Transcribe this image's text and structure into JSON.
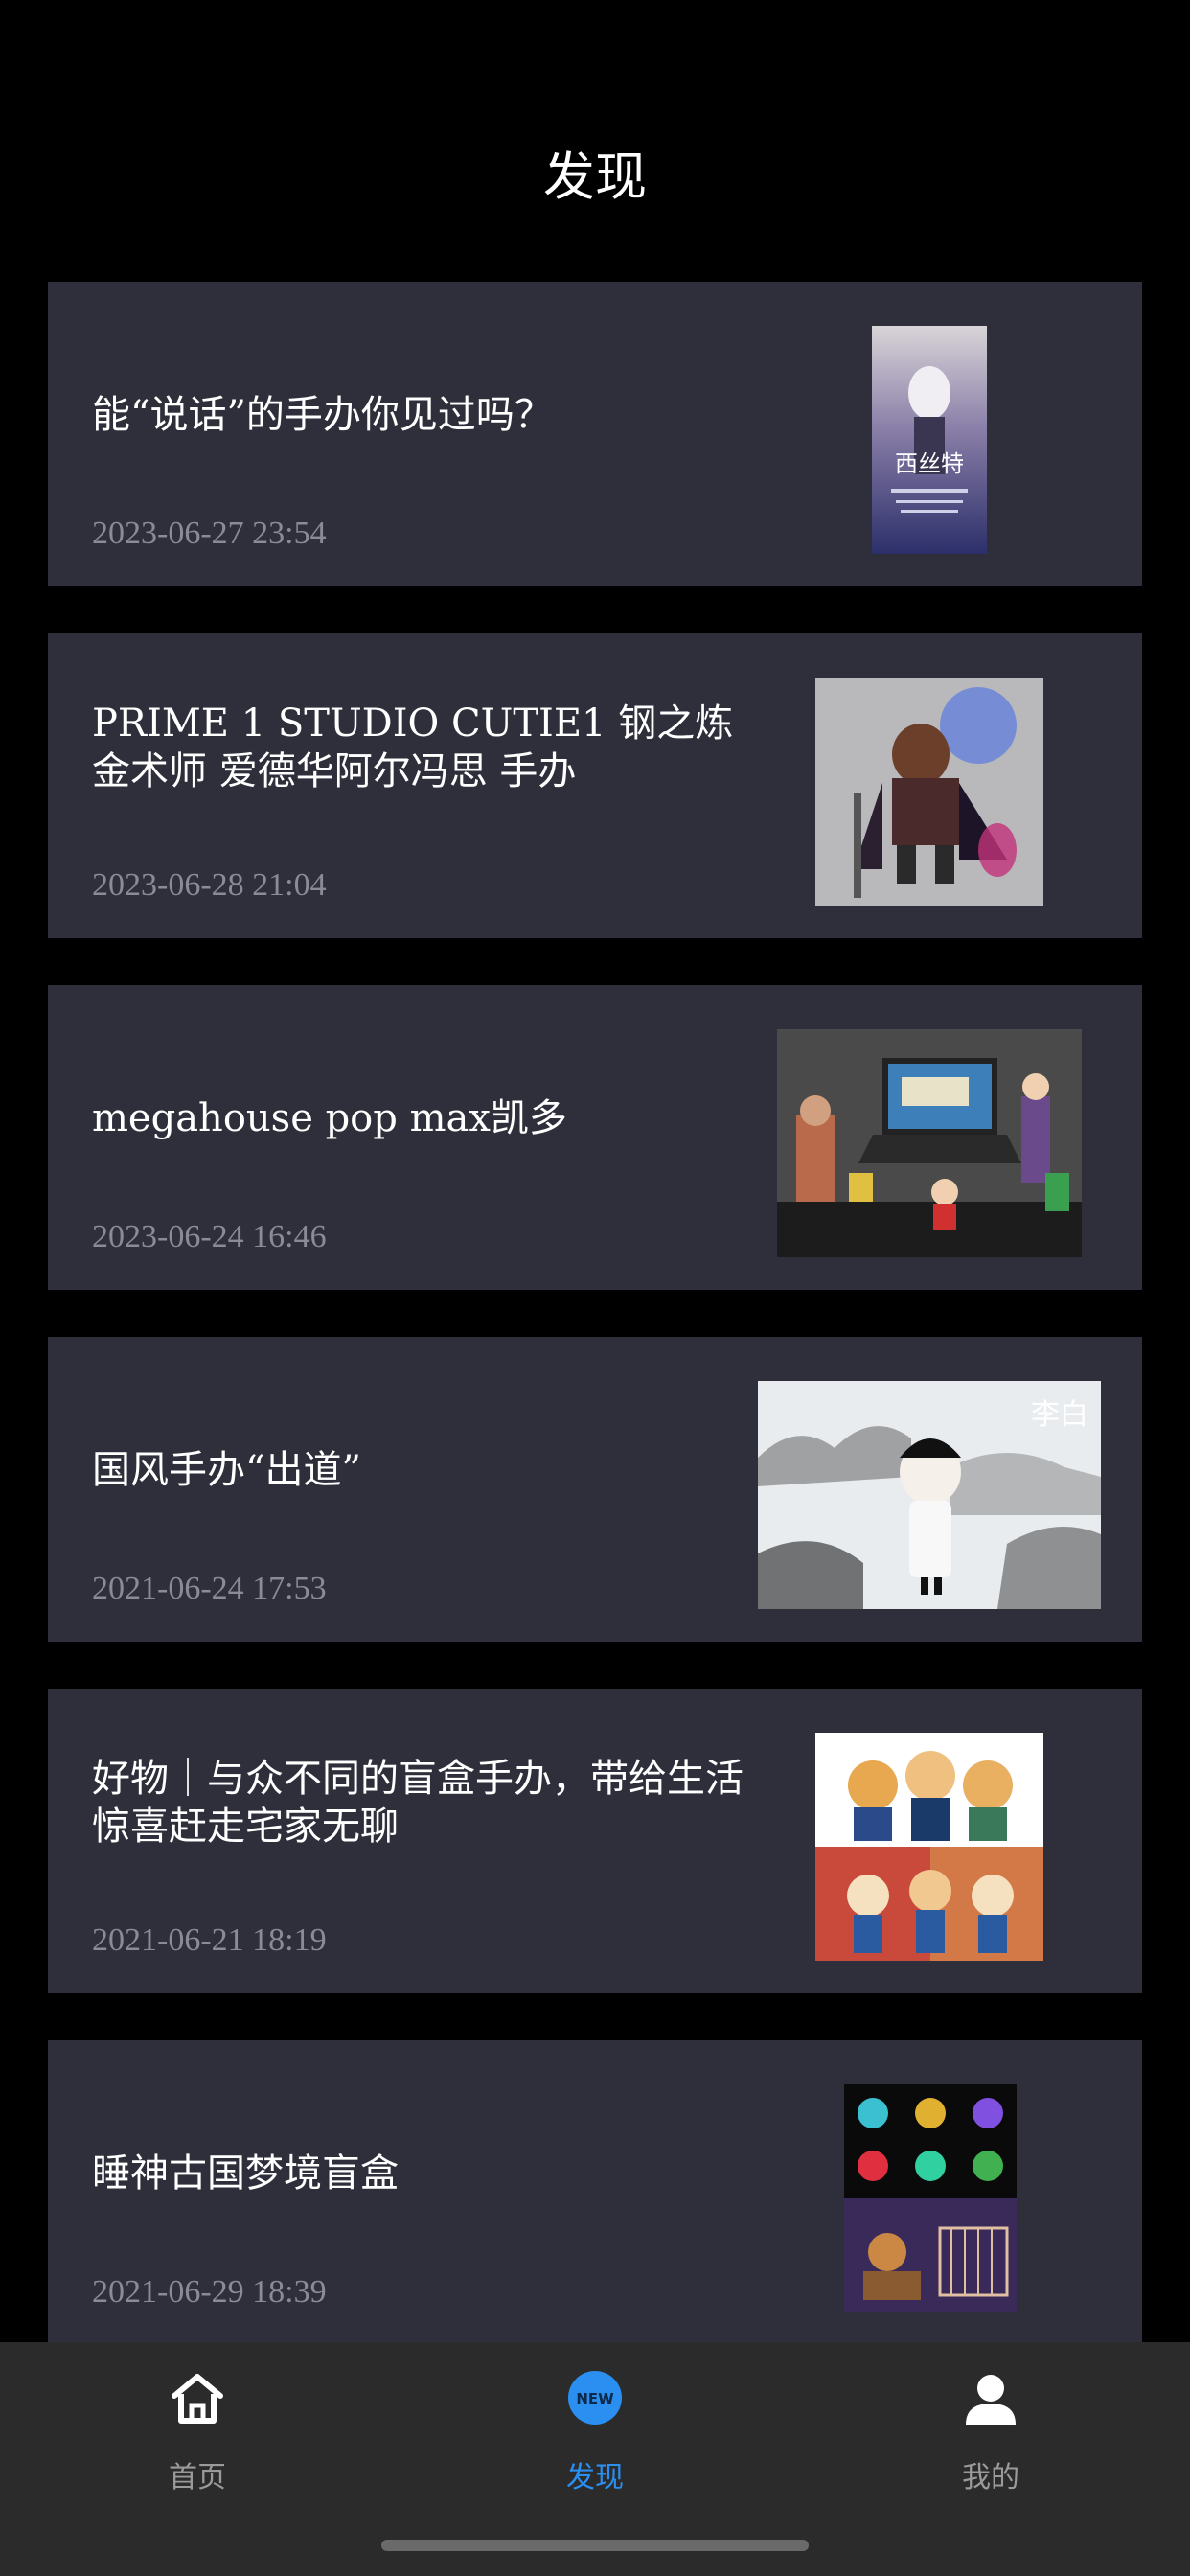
{
  "header": {
    "title": "发现"
  },
  "articles": [
    {
      "title": "能“说话”的手办你见过吗？",
      "date": "2023-06-27 23:54",
      "thumb_icon": "figure-poster-image"
    },
    {
      "title": "PRIME 1 STUDIO CUTIE1 钢之炼金术师 爱德华阿尔冯思 手办",
      "date": "2023-06-28 21:04",
      "thumb_icon": "figure-statue-image"
    },
    {
      "title": "megahouse pop max凯多",
      "date": "2023-06-24 16:46",
      "thumb_icon": "desk-figures-image"
    },
    {
      "title": "国风手办“出道”",
      "date": "2021-06-24 17:53",
      "thumb_icon": "ink-painting-figure-image"
    },
    {
      "title": "好物｜与众不同的盲盒手办，带给生活惊喜赶走宅家无聊",
      "date": "2021-06-21 18:19",
      "thumb_icon": "cat-figures-image"
    },
    {
      "title": "睡神古国梦境盲盒",
      "date": "2021-06-29 18:39",
      "thumb_icon": "crystal-lamps-image"
    }
  ],
  "thumb_poster_caption": "西丝特",
  "thumb_ink_caption": "李白",
  "tabbar": {
    "home_label": "首页",
    "discover_label": "发现",
    "discover_badge": "NEW",
    "mine_label": "我的",
    "active_color": "#2a8ff0"
  }
}
